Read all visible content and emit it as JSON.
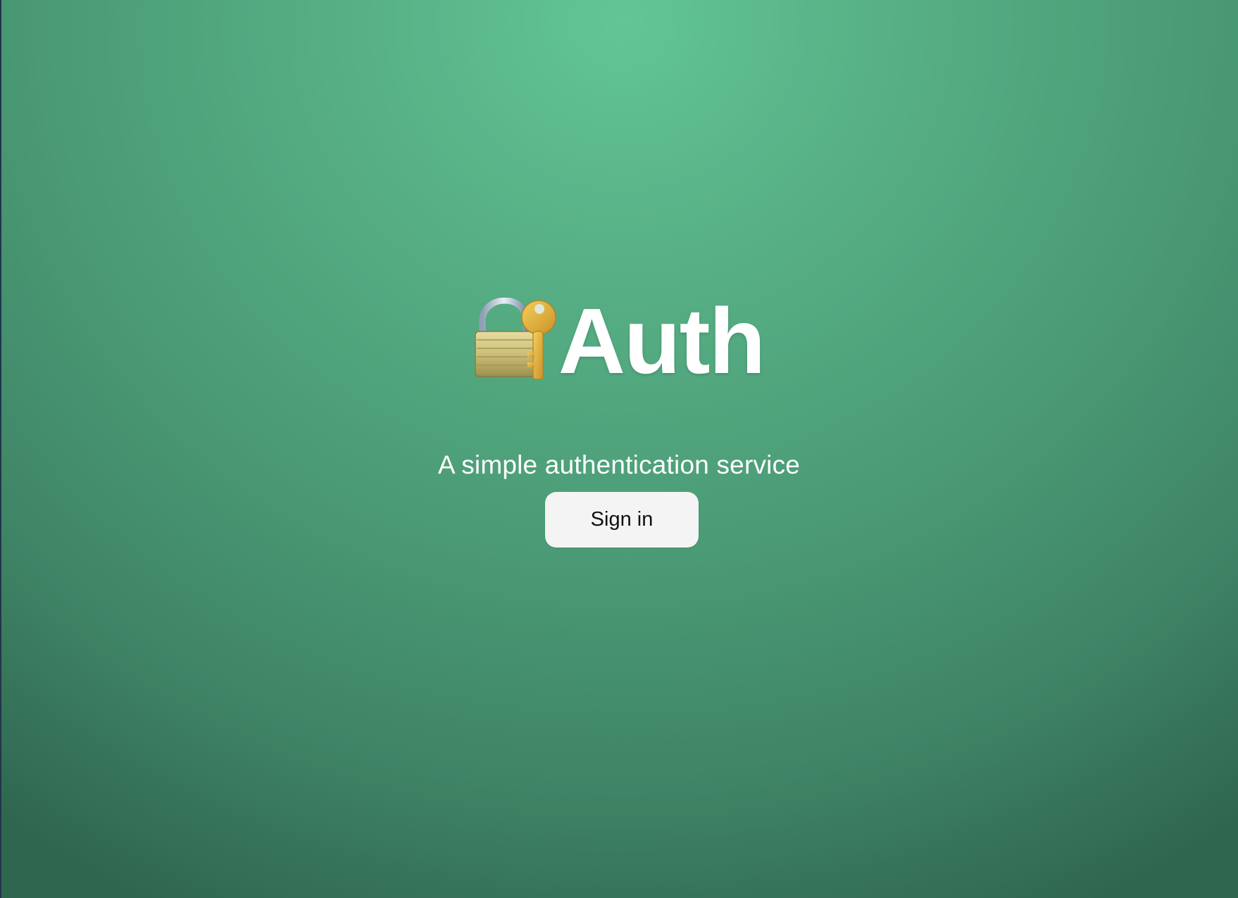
{
  "app": {
    "title": "Auth",
    "subtitle": "A simple authentication service",
    "logo_icon": "locked-with-key-icon"
  },
  "actions": {
    "sign_in_label": "Sign in"
  },
  "colors": {
    "background_light": "#62c594",
    "background_dark": "#2f6650",
    "button_bg": "#f4f4f4",
    "text": "#ffffff"
  }
}
